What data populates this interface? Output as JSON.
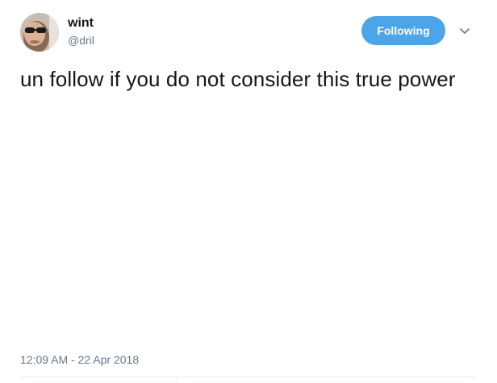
{
  "author": {
    "display_name": "wint",
    "screen_name": "@dril",
    "avatar_icon": "avatar-photo"
  },
  "actions": {
    "follow_label": "Following",
    "follow_color": "#4ca5e8",
    "more_icon": "chevron-down-icon"
  },
  "tweet": {
    "text": "un follow if you do not consider this true power",
    "timestamp": "12:09 AM - 22 Apr 2018"
  }
}
